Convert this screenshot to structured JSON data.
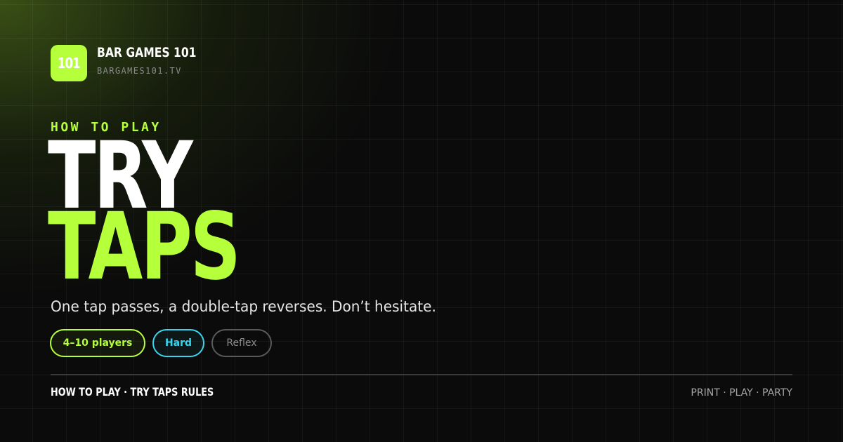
{
  "brand": {
    "logo_text": "101",
    "name": "BAR GAMES 101",
    "url": "BARGAMES101.TV",
    "accent_color": "#b5ff3b"
  },
  "hero": {
    "eyebrow": "HOW TO PLAY",
    "title_line_1": "TRY",
    "title_line_2": "TAPS",
    "tagline": "One tap passes, a double-tap reverses. Don’t hesitate."
  },
  "tags": [
    {
      "label": "4–10 players",
      "color": "#b5ff3b"
    },
    {
      "label": "Hard",
      "color": "#39d5ee"
    },
    {
      "label": "Reflex",
      "color": "#8c8c8c"
    }
  ],
  "footer": {
    "left": "HOW TO PLAY · TRY TAPS RULES",
    "right": "PRINT · PLAY · PARTY"
  }
}
